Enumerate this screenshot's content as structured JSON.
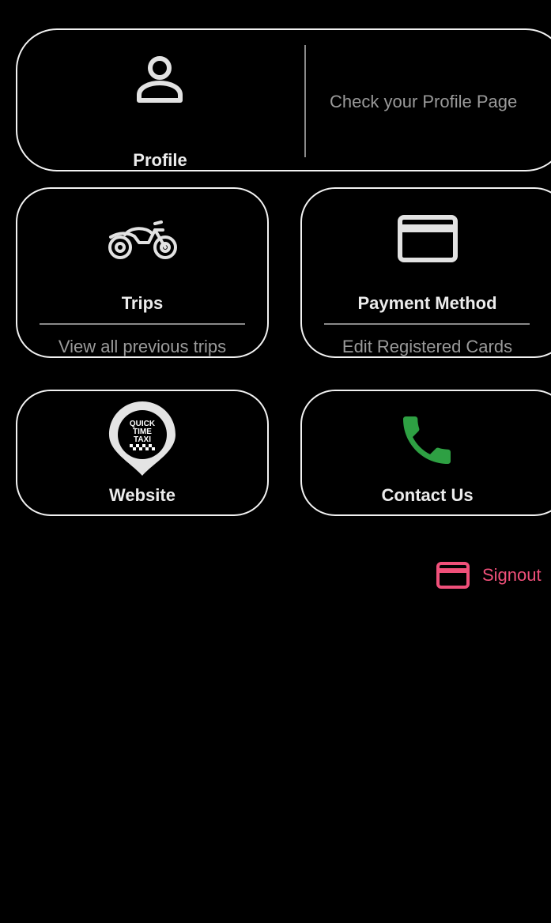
{
  "colors": {
    "background": "#000000",
    "card_border": "#f2f2f2",
    "title_text": "#ececec",
    "subtitle_text": "#9a9a9a",
    "phone_green": "#2ea043",
    "signout_pink": "#f0507a"
  },
  "profile": {
    "title": "Profile",
    "description": "Check your Profile Page",
    "icon": "person-icon"
  },
  "trips": {
    "title": "Trips",
    "subtitle": "View all previous trips",
    "icon": "motorcycle-icon"
  },
  "payment": {
    "title": "Payment Method",
    "subtitle": "Edit Registered Cards",
    "icon": "credit-card-icon"
  },
  "website": {
    "title": "Website",
    "icon": "quick-time-taxi-logo",
    "logo_lines": [
      "QUICK",
      "TIME",
      "TAXI"
    ]
  },
  "contact": {
    "title": "Contact Us",
    "icon": "phone-icon"
  },
  "signout": {
    "label": "Signout",
    "icon": "credit-card-icon"
  }
}
